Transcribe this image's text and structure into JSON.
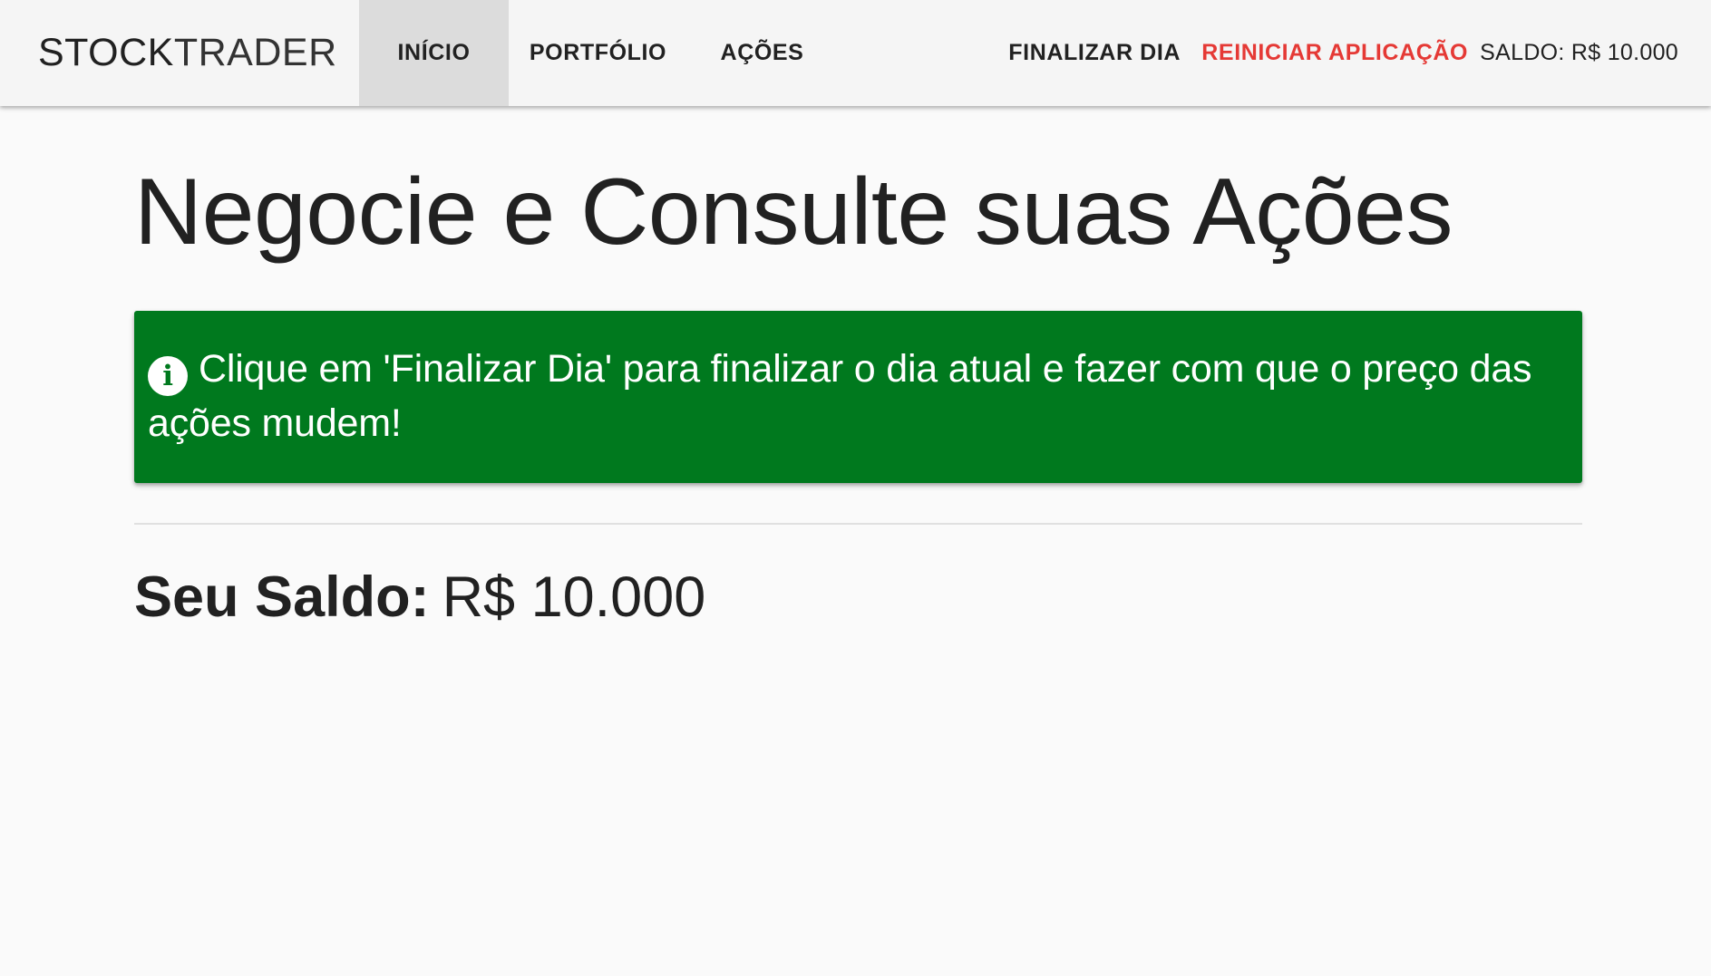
{
  "toolbar": {
    "brand_part1": "STOCK",
    "brand_part2": "TRADER",
    "nav_left": {
      "inicio": "INÍCIO",
      "portfolio": "PORTFÓLIO",
      "acoes": "AÇÕES"
    },
    "nav_right": {
      "finalizar_dia": "FINALIZAR DIA",
      "reiniciar": "REINICIAR APLICAÇÃO"
    },
    "saldo": "SALDO: R$ 10.000",
    "active_tab": "INÍCIO"
  },
  "main": {
    "title": "Negocie e Consulte suas Ações",
    "alert": {
      "icon": "info-circle-icon",
      "text": "Clique em 'Finalizar Dia' para finalizar o dia atual e fazer com que o preço das ações mudem!"
    },
    "balance_label": "Seu Saldo:",
    "balance_value": "R$ 10.000"
  },
  "colors": {
    "alert_background": "#00791e",
    "reset_link": "#e53935",
    "active_tab_background": "#dcdcdc",
    "toolbar_background": "#f5f5f5"
  }
}
